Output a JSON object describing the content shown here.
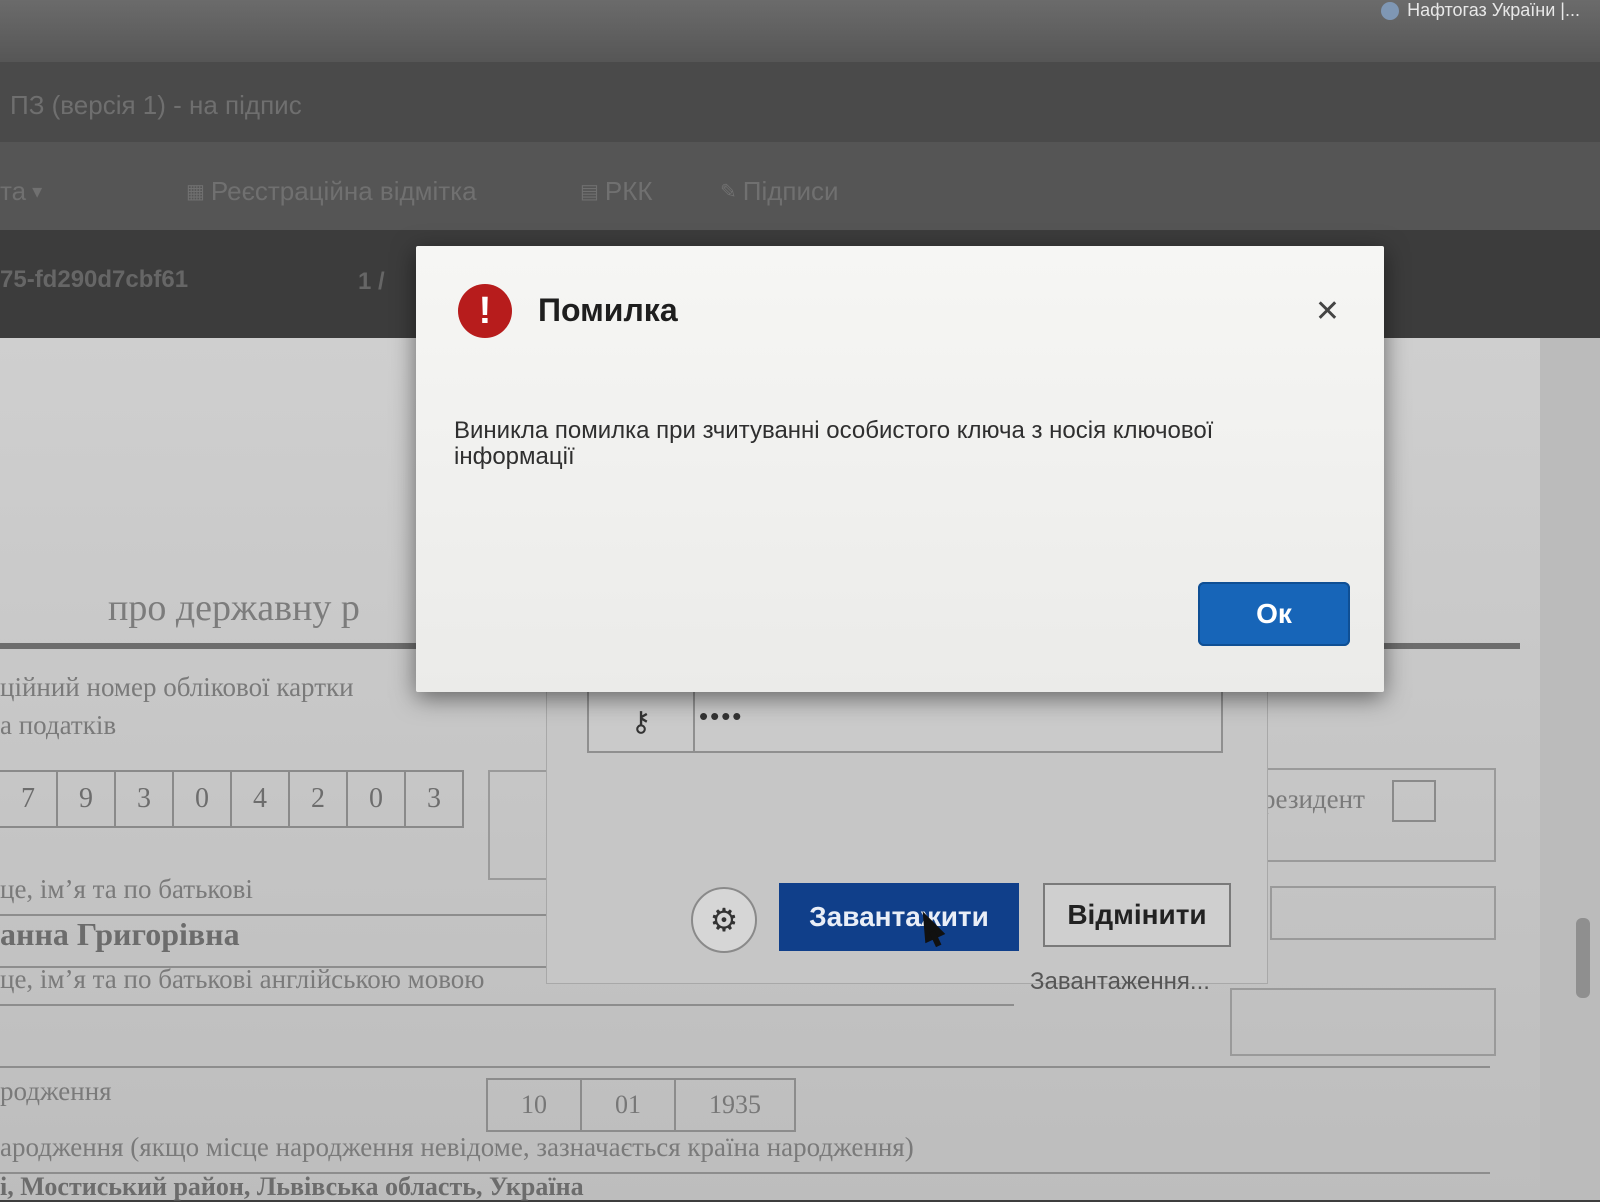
{
  "browser": {
    "bookmark_label": "Нафтогаз України |..."
  },
  "app": {
    "title_text": "ПЗ (версія 1) - на підпис",
    "toolbar": [
      {
        "icon": "▾",
        "label": "та"
      },
      {
        "icon": "▦",
        "label": "Реєстраційна відмітка"
      },
      {
        "icon": "▤",
        "label": "РКК"
      },
      {
        "icon": "✎",
        "label": "Підписи"
      }
    ],
    "doc_id": "75-fd290d7cbf61",
    "page_indicator": "1 /"
  },
  "document": {
    "title": "про державну р",
    "tax_label_1": "ційний номер облікової картки",
    "tax_label_2": "а податків",
    "tax_digits": [
      "7",
      "9",
      "3",
      "0",
      "4",
      "2",
      "0",
      "3"
    ],
    "resident_label": "резидент",
    "name_label": "це, ім’я та по батькові",
    "name_value": "анна Григорівна",
    "name_en_label": "це, ім’я та по батькові англійською мовою",
    "birth_label": "родження",
    "birth_date": [
      "10",
      "01",
      "1935"
    ],
    "birthplace_label": "ародження (якщо місце народження невідоме, зазначається країна народження)",
    "birthplace_value": "і, Мостиський район, Львівська область, Україна"
  },
  "key_panel": {
    "key_icon": "key-icon",
    "masked_password": "••••",
    "settings_icon": "gear-icon",
    "load_button": "Завантажити",
    "cancel_button": "Відмінити",
    "loading_text": "Завантаження..."
  },
  "dialog": {
    "title": "Помилка",
    "error_glyph": "!",
    "close_glyph": "✕",
    "message": "Виникла помилка при зчитуванні особистого ключа з носія ключової інформації",
    "ok_button": "Ок",
    "colors": {
      "ok": "#1765b8",
      "error": "#b71c1c"
    }
  }
}
